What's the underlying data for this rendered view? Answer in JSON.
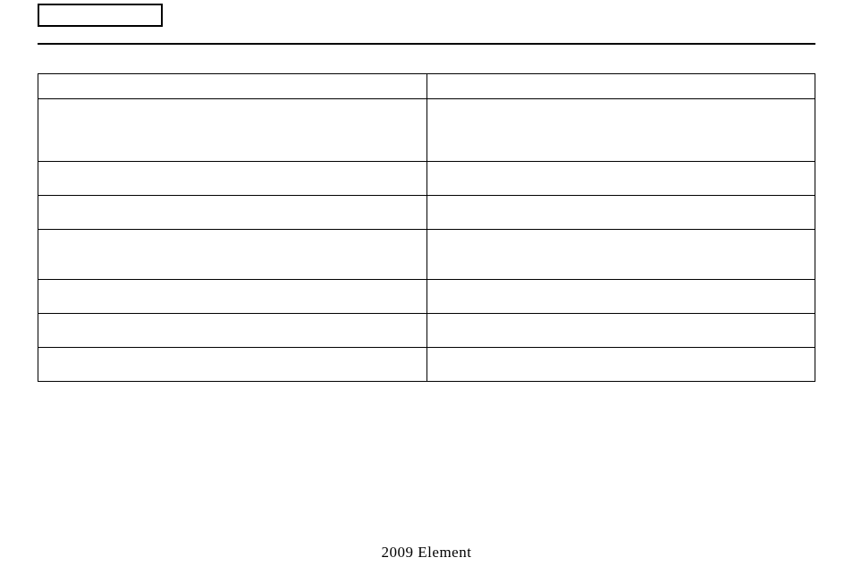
{
  "footer": {
    "text": "2009 Element"
  },
  "table": {
    "header": {
      "left": "",
      "right": ""
    },
    "rows": [
      {
        "left": "",
        "right": ""
      },
      {
        "left": "",
        "right": ""
      },
      {
        "left": "",
        "right": ""
      },
      {
        "left": "",
        "right": ""
      },
      {
        "left": "",
        "right": ""
      },
      {
        "left": "",
        "right": ""
      },
      {
        "left": "",
        "right": ""
      }
    ]
  }
}
